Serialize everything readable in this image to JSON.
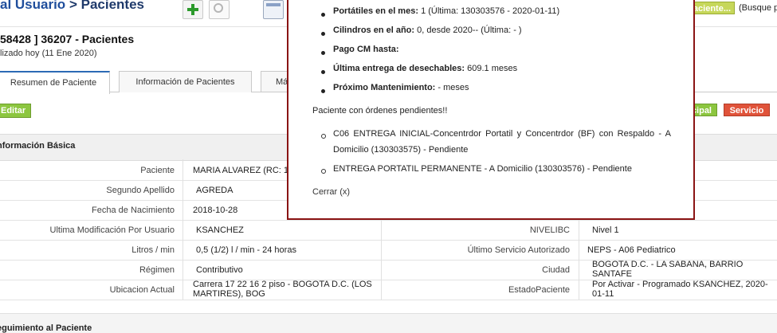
{
  "header": {
    "breadcrumb_prefix": "al Usuario",
    "breadcrumb_sep": ">",
    "breadcrumb_current": "Pacientes",
    "patient_id": "58428 ] 36207 - Pacientes",
    "updated": "lizado hoy (11 Ene 2020)",
    "paciente_button": "aciente...",
    "busque_text": "(Busque p"
  },
  "tabs": [
    {
      "label": "Resumen de Paciente",
      "active": true
    },
    {
      "label": "Información de Pacientes",
      "active": false
    },
    {
      "label": "Má",
      "active": false
    }
  ],
  "actions": {
    "edit": "Editar",
    "principal": "cipal",
    "service": "Servicio"
  },
  "info": {
    "section_title": "nformación Básica",
    "left_rows": [
      {
        "label": "Paciente",
        "value": "MARIA ALVAREZ (RC: 1"
      },
      {
        "label": "Segundo Apellido",
        "value": "AGREDA"
      },
      {
        "label": "Fecha de Nacimiento",
        "value": "2018-10-28"
      },
      {
        "label": "Ultima Modificación Por Usuario",
        "value": "KSANCHEZ"
      },
      {
        "label": "Litros / min",
        "value": "0,5 (1/2) l / min - 24 horas"
      },
      {
        "label": "Régimen",
        "value": "Contributivo"
      },
      {
        "label": "Ubicacion Actual",
        "value": "Carrera 17 22 16 2 piso - BOGOTA D.C. (LOS MARTIRES), BOG"
      }
    ],
    "right_rows": [
      {
        "label": "NIVELIBC",
        "value": "Nivel 1"
      },
      {
        "label": "Último Servicio Autorizado",
        "value": "NEPS - A06 Pediatrico"
      },
      {
        "label": "Ciudad",
        "value": "BOGOTA D.C. - LA SABANA, BARRIO SANTAFE"
      },
      {
        "label": "EstadoPaciente",
        "value": "Por Activar - Programado KSANCHEZ, 2020-01-11"
      }
    ]
  },
  "seguimiento_title": "eguimiento al Paciente",
  "popup": {
    "portatiles_label": "Portátiles en el mes:",
    "portatiles_value": "1 (Última: 130303576 - 2020-01-11)",
    "cilindros_label": "Cilindros en el año:",
    "cilindros_value": "0, desde 2020-- (Última: - )",
    "pago_label": "Pago CM hasta:",
    "desechables_label": "Última entrega de desechables:",
    "desechables_value": "609.1 meses",
    "mantenimiento_label": "Próximo Mantenimiento:",
    "mantenimiento_value": "- meses",
    "pending_title": "Paciente con órdenes pendientes!!",
    "order1_line1": "C06 ENTREGA INICIAL-Concentrdor Portatil y Concentrdor (BF) con Respaldo - A",
    "order1_line2": "Domicilio (130303575) - Pendiente",
    "order2": "ENTREGA PORTATIL PERMANENTE - A Domicilio (130303576) - Pendiente",
    "close": "Cerrar (x)"
  }
}
